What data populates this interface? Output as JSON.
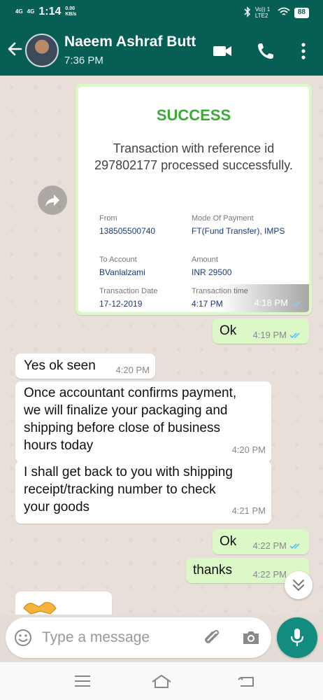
{
  "status_bar": {
    "signal1": "4G",
    "signal2": "4G",
    "time": "1:14",
    "speed_value": "0.00",
    "speed_unit": "KB/s",
    "network_label": "Vo)) 1 LTE2",
    "battery": "88"
  },
  "header": {
    "contact_name": "Naeem Ashraf Butt",
    "last_seen": "7:36 PM"
  },
  "receipt": {
    "heading": "SUCCESS",
    "message": "Transaction with reference id 297802177 processed successfully.",
    "from_label": "From",
    "from_value": "138505500740",
    "mode_label": "Mode Of Payment",
    "mode_value": "FT(Fund Transfer), IMPS",
    "to_label": "To Account",
    "to_value": "BVanlalzami",
    "amount_label": "Amount",
    "amount_value": "INR 29500",
    "date_label": "Transaction Date",
    "date_value": "17-12-2019",
    "time_label": "Transaction time",
    "time_value": "4:17 PM",
    "sent_time": "4:18 PM"
  },
  "messages": [
    {
      "dir": "out",
      "text": "Ok",
      "time": "4:19 PM"
    },
    {
      "dir": "in",
      "text": "Yes ok seen",
      "time": "4:20 PM"
    },
    {
      "dir": "in",
      "lines": [
        "Once accountant confirms payment,",
        "we will finalize your packaging and",
        "shipping before close of business",
        "hours today"
      ],
      "time": "4:20 PM"
    },
    {
      "dir": "in",
      "lines": [
        "I shall get back to you with shipping",
        "receipt/tracking number to check",
        "your goods"
      ],
      "time": "4:21 PM"
    },
    {
      "dir": "out",
      "text": "Ok",
      "time": "4:22 PM"
    },
    {
      "dir": "out",
      "text": "thanks",
      "time": "4:22 PM"
    }
  ],
  "compose": {
    "placeholder": "Type a message"
  },
  "colors": {
    "header": "#075e54",
    "outgoing_bubble": "#dcf8c6",
    "incoming_bubble": "#ffffff",
    "read_ticks": "#4fc3f7",
    "success_green": "#3aaa35",
    "mic_button": "#128c7e"
  },
  "icons": {
    "back": "arrow-left-icon",
    "video": "video-call-icon",
    "call": "phone-icon",
    "menu": "more-vert-icon",
    "forward": "share-forward-icon",
    "emoji": "emoji-icon",
    "attach": "paperclip-icon",
    "camera": "camera-icon",
    "mic": "microphone-icon",
    "scroll": "double-chevron-down-icon"
  }
}
